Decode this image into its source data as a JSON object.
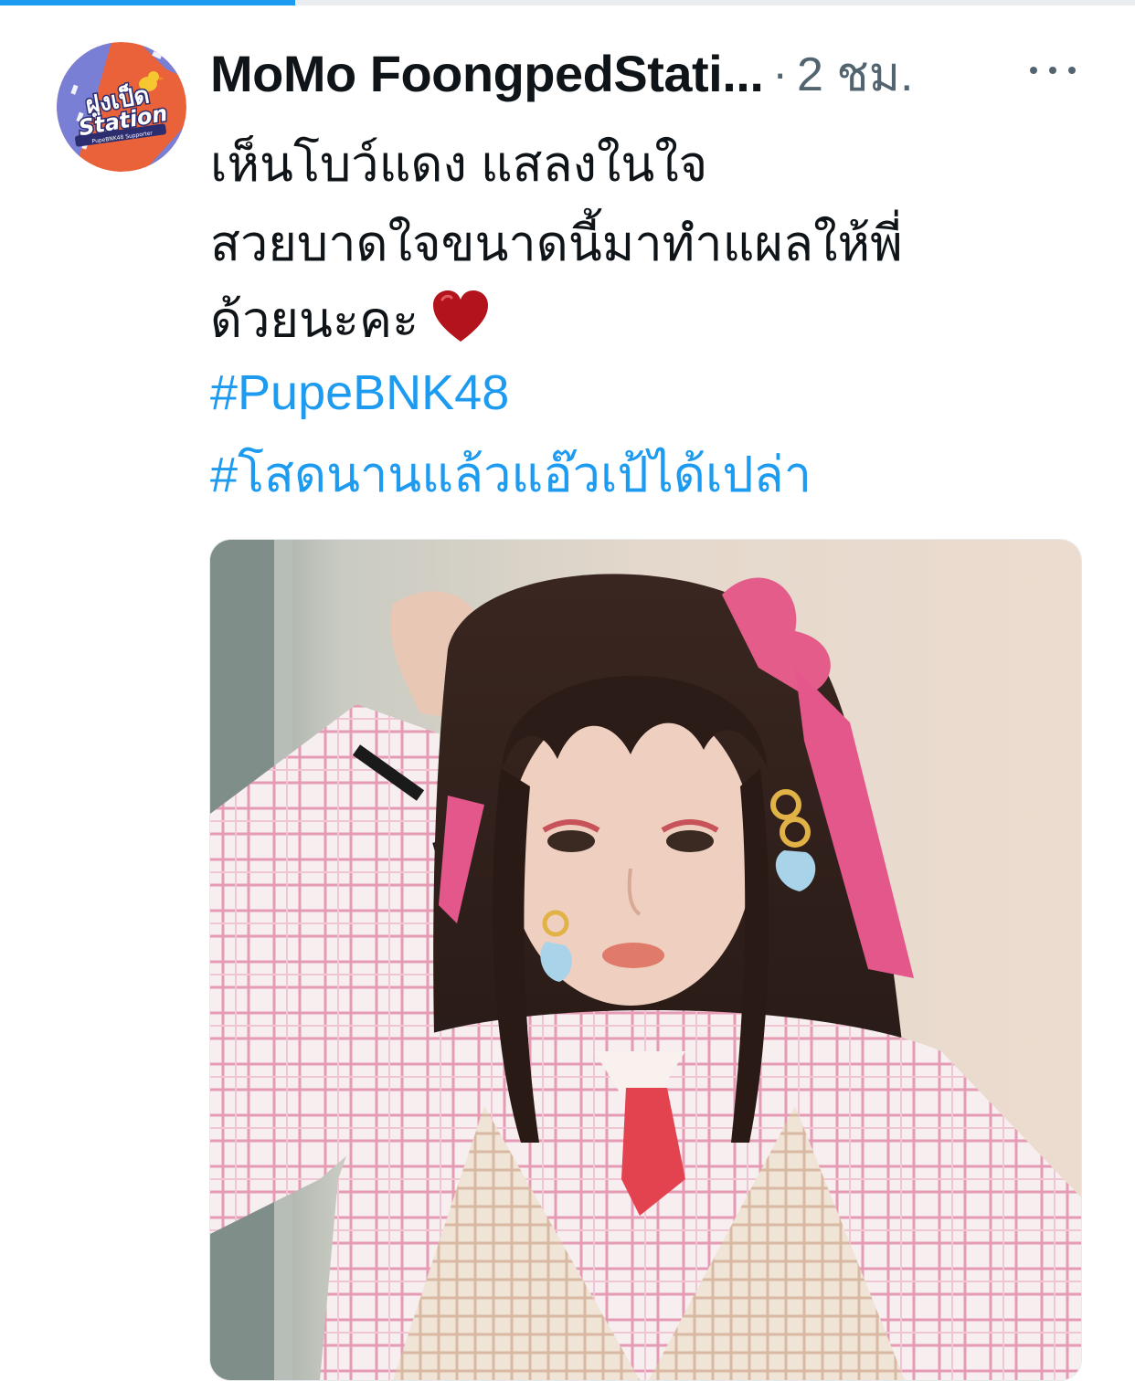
{
  "load_progress": 0.26,
  "tweet": {
    "display_name": "MoMo FoongpedStati...",
    "separator": "·",
    "time": "2 ชม.",
    "lines": [
      "เห็นโบว์แดง แสลงในใจ",
      "สวยบาดใจขนาดนี้มาทำแผลให้พี่",
      "ด้วยนะคะ"
    ],
    "emoji": "heart-icon",
    "hashtags": [
      "#PupeBNK48",
      "#โสดนานแล้วแอ๊วเป้ได้เปล่า"
    ]
  },
  "avatar": {
    "logo_text_top": "ฝูงเป็ด",
    "logo_text_bottom": "Station",
    "logo_small_text": "PupeBNK48 Supporter"
  },
  "colors": {
    "accent": "#1d9bf0",
    "text": "#0f1419",
    "muted": "#536471"
  }
}
